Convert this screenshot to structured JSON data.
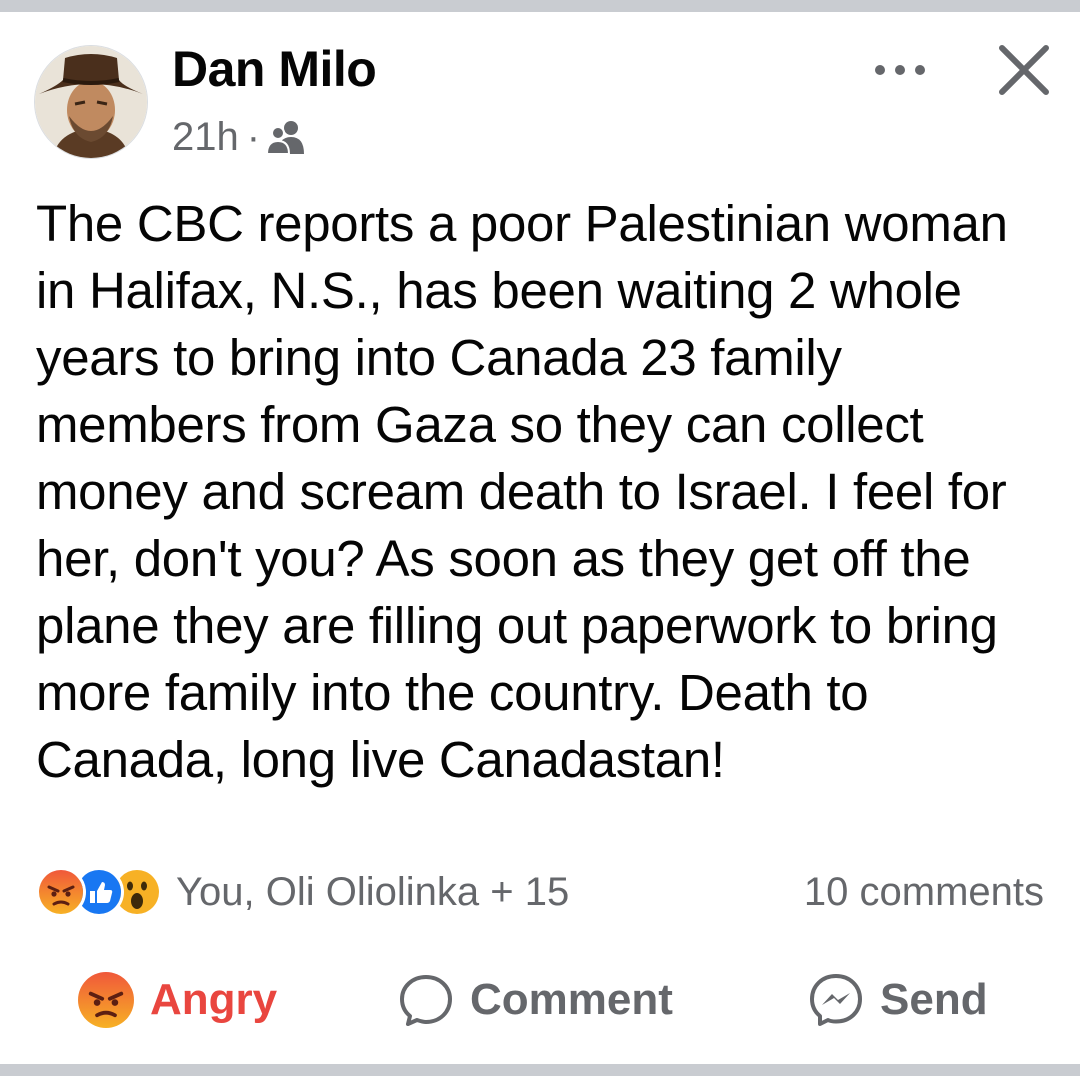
{
  "post": {
    "author": "Dan Milo",
    "time": "21h",
    "separator": "·",
    "audience_icon": "friends-icon",
    "text": "The CBC reports a poor Palestinian woman in Halifax, N.S., has been waiting 2 whole years to bring into Canada 23 family members from Gaza so they can collect money and scream death to Israel. I feel for her, don't you? As soon as they get off the plane they are filling out paperwork to bring more family into the country. Death to Canada, long live Canadastan!"
  },
  "reactions": {
    "icons": [
      "angry-icon",
      "like-icon",
      "wow-icon"
    ],
    "names": "You, Oli Oliolinka + 15",
    "comments": "10 comments"
  },
  "actions": {
    "react_label": "Angry",
    "comment_label": "Comment",
    "send_label": "Send"
  },
  "colors": {
    "angry": "#e9463f",
    "like": "#1877f2",
    "wow": "#f7b125",
    "secondary_text": "#65676b",
    "primary_text": "#050505"
  }
}
